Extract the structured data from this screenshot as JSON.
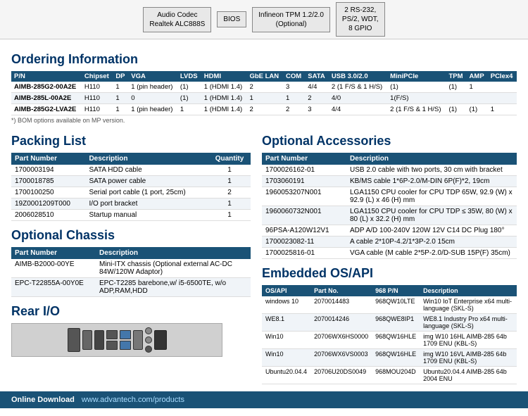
{
  "top_diagram": {
    "boxes": [
      {
        "label": "Audio Codec\nRealtek ALC888S"
      },
      {
        "label": "BIOS"
      },
      {
        "label": "Infineon TPM 1.2/2.0\n(Optional)"
      },
      {
        "label": "2 RS-232,\nPS/2, WDT,\n8 GPIO"
      }
    ]
  },
  "ordering": {
    "title": "Ordering Information",
    "columns": [
      "P/N",
      "Chipset",
      "DP",
      "VGA",
      "LVDS",
      "HDMI",
      "GbE LAN",
      "COM",
      "SATA",
      "USB 3.0/2.0",
      "MiniPCIe",
      "TPM",
      "AMP",
      "PCIex4"
    ],
    "rows": [
      [
        "AIMB-285G2-00A2E",
        "H110",
        "1",
        "1 (pin header)",
        "(1)",
        "1 (HDMI 1.4)",
        "2",
        "3",
        "4/4",
        "2 (1 F/S & 1 H/S)",
        "(1)",
        "(1)",
        "1",
        ""
      ],
      [
        "AIMB-285L-00A2E",
        "H110",
        "1",
        "0",
        "(1)",
        "1 (HDMI 1.4)",
        "1",
        "1",
        "2",
        "4/0",
        "1(F/S)",
        "",
        "",
        ""
      ],
      [
        "AIMB-285G2-LVA2E",
        "H110",
        "1",
        "1 (pin header)",
        "1",
        "1 (HDMI 1.4)",
        "2",
        "2",
        "3",
        "4/4",
        "2 (1 F/S & 1 H/S)",
        "(1)",
        "(1)",
        "1"
      ]
    ],
    "footnote": "*) BOM options available on MP version."
  },
  "packing_list": {
    "title": "Packing List",
    "columns": [
      "Part Number",
      "Description",
      "Quantity"
    ],
    "rows": [
      [
        "1700003194",
        "SATA HDD cable",
        "1"
      ],
      [
        "1700018785",
        "SATA power cable",
        "1"
      ],
      [
        "1700100250",
        "Serial port cable (1 port, 25cm)",
        "2"
      ],
      [
        "19Z0001209T000",
        "I/O port bracket",
        "1"
      ],
      [
        "2006028510",
        "Startup manual",
        "1"
      ]
    ]
  },
  "optional_chassis": {
    "title": "Optional Chassis",
    "columns": [
      "Part Number",
      "Description"
    ],
    "rows": [
      [
        "AIMB-B2000-00YE",
        "Mini-ITX chassis (Optional external AC-DC 84W/120W Adaptor)"
      ],
      [
        "EPC-T22855A-00Y0E",
        "EPC-T2285 barebone,w/ i5-6500TE, w/o ADP,RAM,HDD"
      ]
    ]
  },
  "optional_accessories": {
    "title": "Optional Accessories",
    "columns": [
      "Part Number",
      "Description"
    ],
    "rows": [
      [
        "1700026162-01",
        "USB 2.0 cable with two ports, 30 cm with bracket"
      ],
      [
        "1703060191",
        "KB/MS cable 1*6P-2.0/M-DIN 6P(F)*2, 19cm"
      ],
      [
        "1960053207N001",
        "LGA1150 CPU cooler for CPU TDP 65W,\n92.9 (W) x 92.9 (L) x 46 (H) mm"
      ],
      [
        "1960060732N001",
        "LGA1150 CPU cooler for CPU TDP ≤ 35W,\n80 (W) x 80 (L) x 32.2 (H) mm"
      ],
      [
        "96PSA-A120W12V1",
        "ADP A/D 100-240V 120W 12V C14 DC Plug 180°"
      ],
      [
        "1700023082-11",
        "A cable 2*10P-4.2/1*3P-2.0 15cm"
      ],
      [
        "1700025816-01",
        "VGA cable (M cable 2*5P-2.0/D-SUB 15P(F) 35cm)"
      ]
    ]
  },
  "rear_io": {
    "title": "Rear I/O"
  },
  "embedded_os": {
    "title": "Embedded OS/API",
    "columns": [
      "OS/API",
      "Part No.",
      "968 P/N",
      "Description"
    ],
    "rows": [
      [
        "windows 10",
        "2070014483",
        "968QW10LTE",
        "Win10 IoT Enterprise x64 multi-language (SKL-S)"
      ],
      [
        "WE8.1",
        "2070014246",
        "968QWE8IP1",
        "WE8.1 Industry Pro x64 multi-language (SKL-S)"
      ],
      [
        "Win10",
        "20706WX6HS0000",
        "968QW16HLE",
        "img W10 16HL AIMB-285 64b 1709 ENU (KBL-S)"
      ],
      [
        "Win10",
        "20706WX6VS0003",
        "968QW16HLE",
        "img W10 16VL AIMB-285 64b 1709 ENU (KBL-S)"
      ],
      [
        "Ubuntu20.04.4",
        "20706U20DS0049",
        "968MOU204D",
        "Ubuntu20.04.4 AIMB-285 64b 2004 ENU"
      ]
    ]
  },
  "bottom_bar": {
    "label": "Online Download",
    "url": "www.advantech.com/products"
  }
}
